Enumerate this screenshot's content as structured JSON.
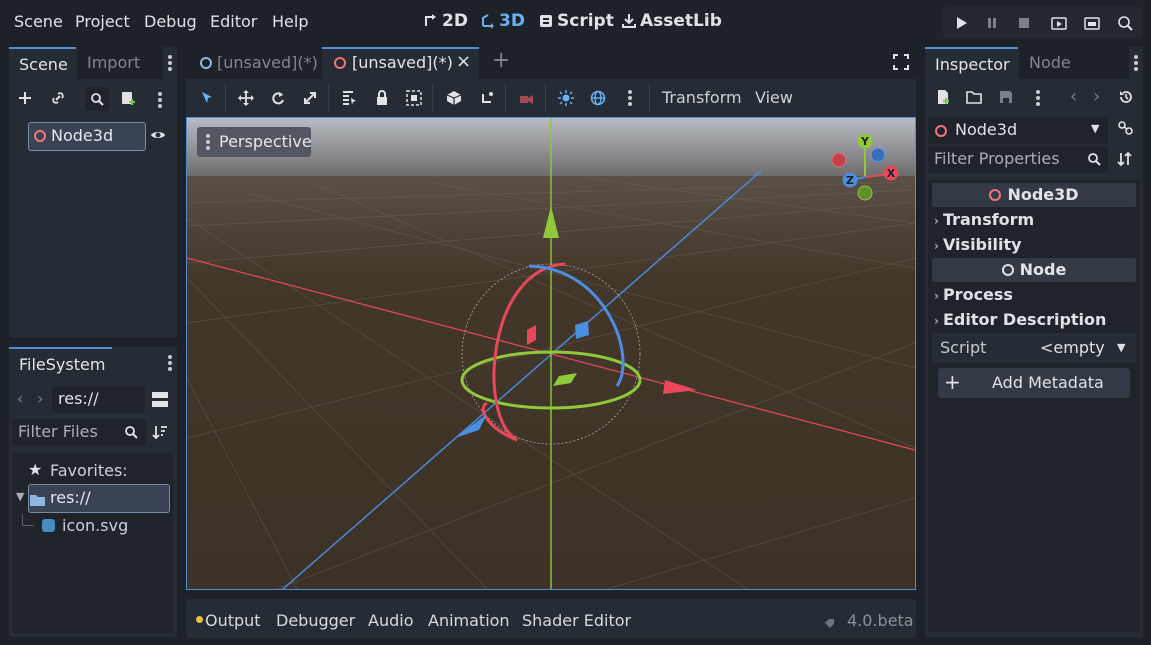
{
  "menu": [
    "Scene",
    "Project",
    "Debug",
    "Editor",
    "Help"
  ],
  "workspaces": [
    {
      "label": "2D",
      "icon": "2d-icon"
    },
    {
      "label": "3D",
      "icon": "3d-icon",
      "active": true
    },
    {
      "label": "Script",
      "icon": "script-icon"
    },
    {
      "label": "AssetLib",
      "icon": "assetlib-icon"
    }
  ],
  "scene_dock": {
    "tabs": [
      "Scene",
      "Import"
    ],
    "root_node": "Node3d"
  },
  "filesystem": {
    "tab": "FileSystem",
    "path": "res://",
    "filter_placeholder": "Filter Files",
    "favorites": "Favorites:",
    "root": "res://",
    "file": "icon.svg"
  },
  "editor_tabs": [
    "[unsaved](*)",
    "[unsaved](*)"
  ],
  "viewport": {
    "toolbar_menus": [
      "Transform",
      "View"
    ],
    "perspective_label": "Perspective",
    "gizmo_labels": {
      "y": "Y",
      "x": "X",
      "z": "Z"
    }
  },
  "bottom_panel": {
    "tabs": [
      "Output",
      "Debugger",
      "Audio",
      "Animation",
      "Shader Editor"
    ],
    "version": "4.0.beta"
  },
  "inspector": {
    "tabs": [
      "Inspector",
      "Node"
    ],
    "selected_node": "Node3d",
    "filter_placeholder": "Filter Properties",
    "class_header": "Node3D",
    "groups1": [
      "Transform",
      "Visibility"
    ],
    "class_header2": "Node",
    "groups2": [
      "Process",
      "Editor Description"
    ],
    "script_label": "Script",
    "script_value": "<empty",
    "add_metadata": "Add Metadata"
  },
  "colors": {
    "accent": "#6ab0f3",
    "x_axis": "#e8485a",
    "y_axis": "#8fc93a",
    "z_axis": "#4a8fe0",
    "ground": "#3f3328",
    "sky": "#b9bcc4"
  }
}
